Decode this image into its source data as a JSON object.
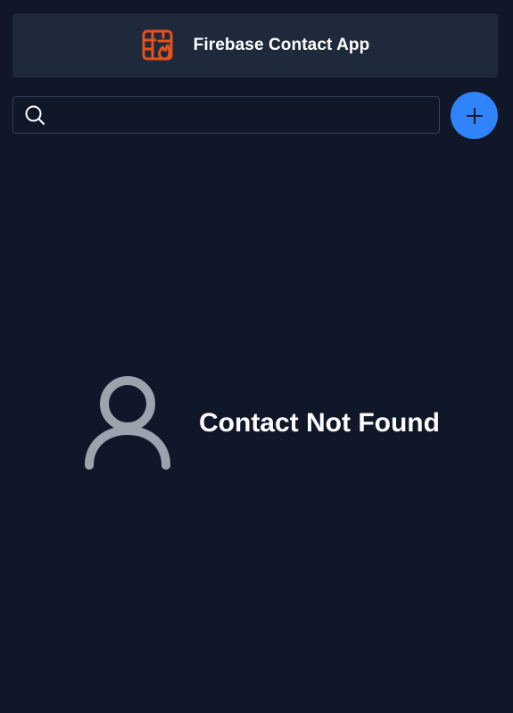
{
  "header": {
    "title": "Firebase Contact App",
    "logo_icon": "firebase-flame-logo-icon",
    "logo_color": "#e8501c"
  },
  "search": {
    "value": "",
    "placeholder": "",
    "icon": "search-icon"
  },
  "actions": {
    "add_icon": "plus-icon",
    "add_color": "#3083f8"
  },
  "empty_state": {
    "icon": "user-icon",
    "message": "Contact Not Found"
  },
  "colors": {
    "background": "#0f1729",
    "panel": "#1e293b",
    "border": "#334155",
    "text": "#ffffff",
    "muted_icon": "#9ca3af"
  }
}
